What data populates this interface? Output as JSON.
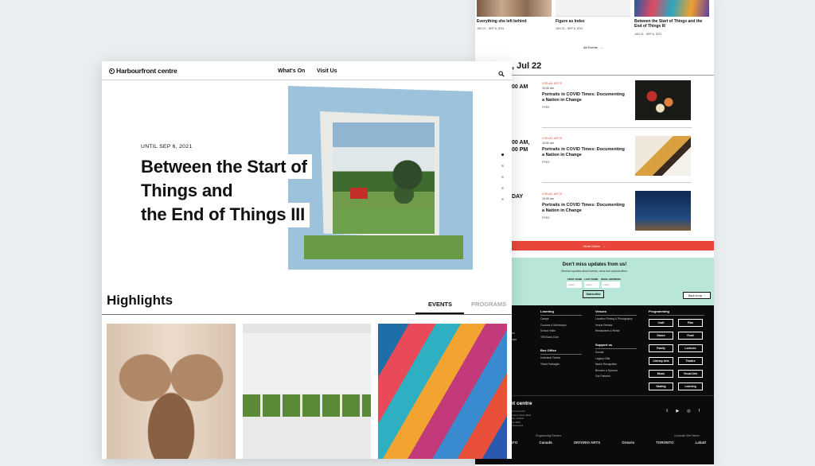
{
  "back": {
    "top_cards": [
      {
        "title": "Everything she left behind",
        "date": "JUN 21 - SEP 6, 2021"
      },
      {
        "title": "Figure as Index",
        "date": "JUN 21 - SEP 6, 2021"
      },
      {
        "title": "Between the Start of Things and the End of Things III",
        "date": "JUN 21 - SEP 6, 2021"
      }
    ],
    "all_events": "All Events",
    "date_heading": ", Jul 22",
    "times": [
      "00 AM",
      "00 AM,\n00 PM",
      "DAY"
    ],
    "events": [
      {
        "category": "VISUAL ARTS",
        "time": "10:00 am",
        "title": "Portraits in COVID Times: Documenting a Nation in Change",
        "price": "FREE"
      },
      {
        "category": "VISUAL ARTS",
        "time": "10:00 am",
        "title": "Portraits in COVID Times: Documenting a Nation in Change",
        "price": "FREE"
      },
      {
        "category": "VISUAL ARTS",
        "time": "10:00 am",
        "title": "Portraits in COVID Times: Documenting a Nation in Change",
        "price": "FREE"
      }
    ],
    "more_dates": "More Dates",
    "newsletter": {
      "title": "Don't miss updates from us!",
      "sub": "Receive updates about events, news and special offers.",
      "labels": [
        "FIRST NAME",
        "LAST NAME",
        "EMAIL ADDRESS"
      ],
      "placeholders": [
        "Label",
        "Label",
        "Label"
      ],
      "subscribe": "Subscribe",
      "back_to_top": "Back to top"
    },
    "footer": {
      "learning": {
        "title": "Learning",
        "items": [
          "Camps",
          "Courses & Workshops",
          "School Visits",
          "TiFA Book Club"
        ]
      },
      "box_office": {
        "title": "Box Office",
        "items": [
          "Individual Tickets",
          "Ticket Packages"
        ]
      },
      "venues": {
        "title": "Venues",
        "items": [
          "Location Filming & Photography",
          "Venue Rentals",
          "Restaurants & Retail"
        ]
      },
      "support": {
        "title": "Support us",
        "items": [
          "Donate",
          "Legacy Gifts",
          "Name Recognition",
          "Become a Sponsor",
          "Our Partners"
        ]
      },
      "programming": {
        "title": "Programming",
        "buttons": [
          "Craft",
          "Film",
          "Dance",
          "Food",
          "Family",
          "Lectures",
          "Literary Arts",
          "Theatre",
          "Music",
          "Visual Arts",
          "Skating",
          "Learning"
        ]
      },
      "left_items": [
        "tt",
        "s",
        "ities",
        "amps"
      ],
      "brand_tail": "nt centre",
      "address": [
        "orfront Centre",
        "Queens Quay West",
        "onto, Ontario",
        "973-4000"
      ],
      "rights": "ts Reserved.",
      "partners_label": "Programming Partners",
      "corp_label": "Corporate Site Partner",
      "logos": [
        "NTO",
        "Canadä",
        "ONTARIO ARTS",
        "Ontario",
        "TORONTO",
        "Labatt"
      ]
    }
  },
  "front": {
    "logo": "Harbourfront centre",
    "nav": [
      "What's On",
      "Visit Us"
    ],
    "hero": {
      "date": "UNTIL SEP 6, 2021",
      "title_lines": [
        "Between the Start of",
        "Things and",
        "the End of Things III"
      ]
    },
    "highlights": "Highlights",
    "tabs": [
      "EVENTS",
      "PROGRAMS"
    ]
  },
  "colors": {
    "accent": "#e8463a",
    "mint": "#b8e6d8",
    "footer_bg": "#0b0b0b"
  }
}
